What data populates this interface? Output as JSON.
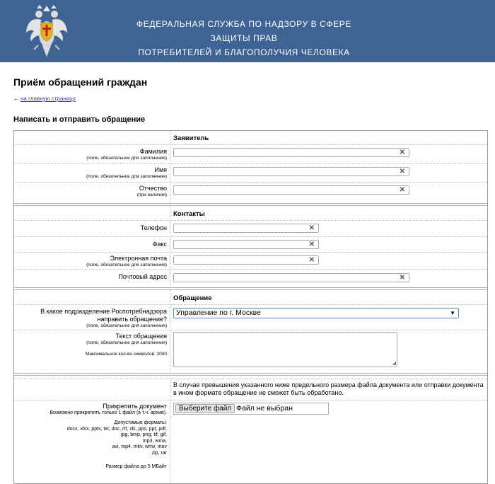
{
  "header": {
    "title_line1": "ФЕДЕРАЛЬНАЯ СЛУЖБА ПО НАДЗОРУ В СФЕРЕ ЗАЩИТЫ ПРАВ",
    "title_line2": "ПОТРЕБИТЕЛЕЙ И БЛАГОПОЛУЧИЯ ЧЕЛОВЕКА",
    "bg_color": "#3d6494"
  },
  "page": {
    "title": "Приём обращений граждан",
    "back_link": "на главную страницу",
    "form_title": "Написать и отправить обращение"
  },
  "applicant": {
    "section": "Заявитель",
    "surname_label": "Фамилия",
    "surname_sub": "(поле, обязательное для заполнения)",
    "name_label": "Имя",
    "name_sub": "(поле, обязательное для заполнения)",
    "patronymic_label": "Отчество",
    "patronymic_sub": "(при наличии)"
  },
  "contacts": {
    "section": "Контакты",
    "phone_label": "Телефон",
    "fax_label": "Факс",
    "email_label": "Электронная почта",
    "email_sub": "(поле, обязательное для заполнения)",
    "address_label": "Почтовый адрес"
  },
  "appeal": {
    "section": "Обращение",
    "division_label_line1": "В какое подразделение Роспотребнадзора",
    "division_label_line2": "направить обращение?",
    "division_sub": "(поле, обязательное для заполнения)",
    "division_value": "Управление по г. Москве",
    "text_label": "Текст обращения",
    "text_sub": "(поле, обязательное для заполнения)",
    "text_max": "Максимальное кол-во символов: 2000"
  },
  "attachment": {
    "note": "В случае превышения указанного ниже предельного размера файла документа или отправки документа в ином формате обращение не сможет быть обработано.",
    "label": "Прикрепить документ",
    "sub": "Возможно прикрепить только 1 файл (в т.ч. архив).",
    "formats_title": "Допустимые форматы:",
    "formats_line1": "docx, xlsx, pptx, txt, doc, rtf, xls, pps, ppt, pdf,",
    "formats_line2": "jpg, bmp, png, tif, gif,",
    "formats_line3": "mp3, wma,",
    "formats_line4": "avi, mp4, mkv, wmv, mov",
    "formats_line5": "zip, rar",
    "size_limit": "Размер файла до 5 МБайт",
    "button": "Выберите файл",
    "status": "Файл не выбран"
  }
}
